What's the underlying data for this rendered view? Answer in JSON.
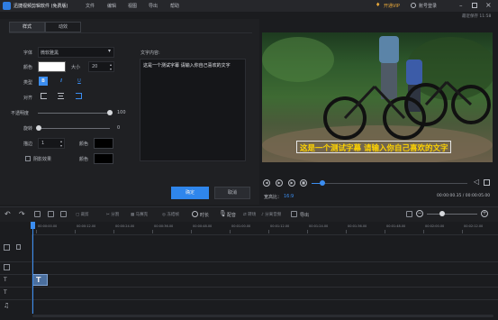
{
  "titlebar": {
    "app_title": "迅捷视频剪辑软件 (免费版)",
    "menus": [
      "文件",
      "编辑",
      "视图",
      "导出",
      "帮助"
    ],
    "vip_label": "开通VIP",
    "account_label": "账号登录"
  },
  "autosave": "最近保存 11:58",
  "panel": {
    "tabs": [
      "样式",
      "动效"
    ],
    "font_label": "字体",
    "font_value": "微软雅黑",
    "color_label": "颜色",
    "color_value": "#ffffff",
    "size_label": "大小",
    "size_value": "20",
    "type_label": "类型",
    "type_buttons": [
      "B",
      "I",
      "U"
    ],
    "align_label": "对齐",
    "opacity_label": "不透明度",
    "opacity_value": "100",
    "rotate_label": "旋转",
    "rotate_value": "0",
    "stroke_label": "描边",
    "stroke_value": "1",
    "stroke_color_label": "颜色",
    "shadow_label": "阴影效果",
    "shadow_color_label": "颜色",
    "content_label": "文字内容:",
    "content_text": "这是一个测试字幕 请输入你自己喜欢的文字",
    "confirm_label": "确定",
    "cancel_label": "取消"
  },
  "preview": {
    "subtitle": "这是一个测试字幕 请输入你自己喜欢的文字",
    "ratio_label": "宽高比：",
    "ratio_value": "16:9",
    "time": "00:00:00.35 / 00:00:05.00",
    "progress": 0.07,
    "volume": 0.6
  },
  "toolbar": {
    "items": [
      "撤销",
      "重做",
      "编辑",
      "删除",
      "裁剪",
      "分割",
      "马赛克",
      "冻结帧",
      "时长",
      "配音",
      "转场",
      "分离音频",
      "导出"
    ],
    "duration_label": "时长",
    "dub_label": "配音",
    "export_label": "导出"
  },
  "timeline": {
    "zoom": 0.3,
    "ticks": [
      "00:00:00.00",
      "00:00:12.00",
      "00:00:24.00",
      "00:00:36.00",
      "00:00:48.00",
      "00:01:00.00",
      "00:01:12.00",
      "00:01:24.00",
      "00:01:36.00",
      "00:01:48.00",
      "00:02:00.00",
      "00:02:12.00"
    ],
    "clip_label": "T"
  },
  "colors": {
    "accent": "#3b8df0",
    "background": "#1b1c1f",
    "panel": "#1f2023",
    "subtitle_text": "#ffd400"
  }
}
